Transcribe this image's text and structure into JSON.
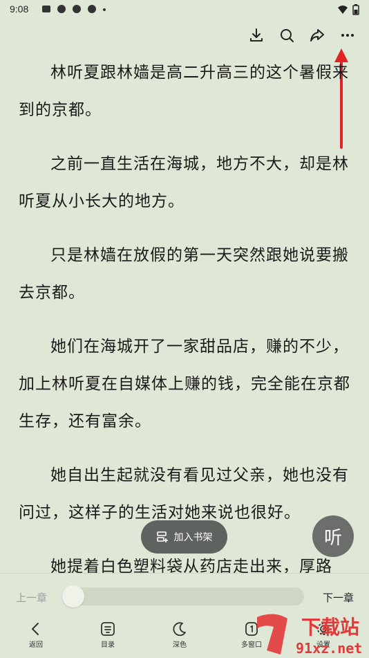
{
  "status_bar": {
    "time": "9:08"
  },
  "toolbar": {
    "icons": [
      "download-icon",
      "search-icon",
      "share-icon",
      "more-icon"
    ]
  },
  "content": {
    "paragraphs": [
      "林听夏跟林嫱是高二升高三的这个暑假来到的京都。",
      "之前一直生活在海城，地方不大，却是林听夏从小长大的地方。",
      "只是林嫱在放假的第一天突然跟她说要搬去京都。",
      "她们在海城开了一家甜品店，赚的不少，加上林听夏在自媒体上赚的钱，完全能在京都生存，还有富余。",
      "她自出生起就没有看见过父亲，她也没有问过，这样子的生活对她来说也很好。",
      "她提着白色塑料袋从药店走出来，厚路"
    ]
  },
  "float": {
    "add_shelf": "加入书架",
    "listen": "听"
  },
  "progress": {
    "prev": "上一章",
    "next": "下一章",
    "value": 0
  },
  "nav": {
    "items": [
      {
        "label": "返回",
        "icon": "back-icon"
      },
      {
        "label": "目录",
        "icon": "catalog-icon"
      },
      {
        "label": "深色",
        "icon": "moon-icon"
      },
      {
        "label": "多窗口",
        "icon": "multi-window-icon"
      },
      {
        "label": "设置",
        "icon": "settings-icon"
      }
    ]
  },
  "watermark": {
    "text1": "下载站",
    "text2": "91xz.net"
  },
  "colors": {
    "background": "#dfe7d6",
    "annotation_arrow": "#e02424"
  }
}
